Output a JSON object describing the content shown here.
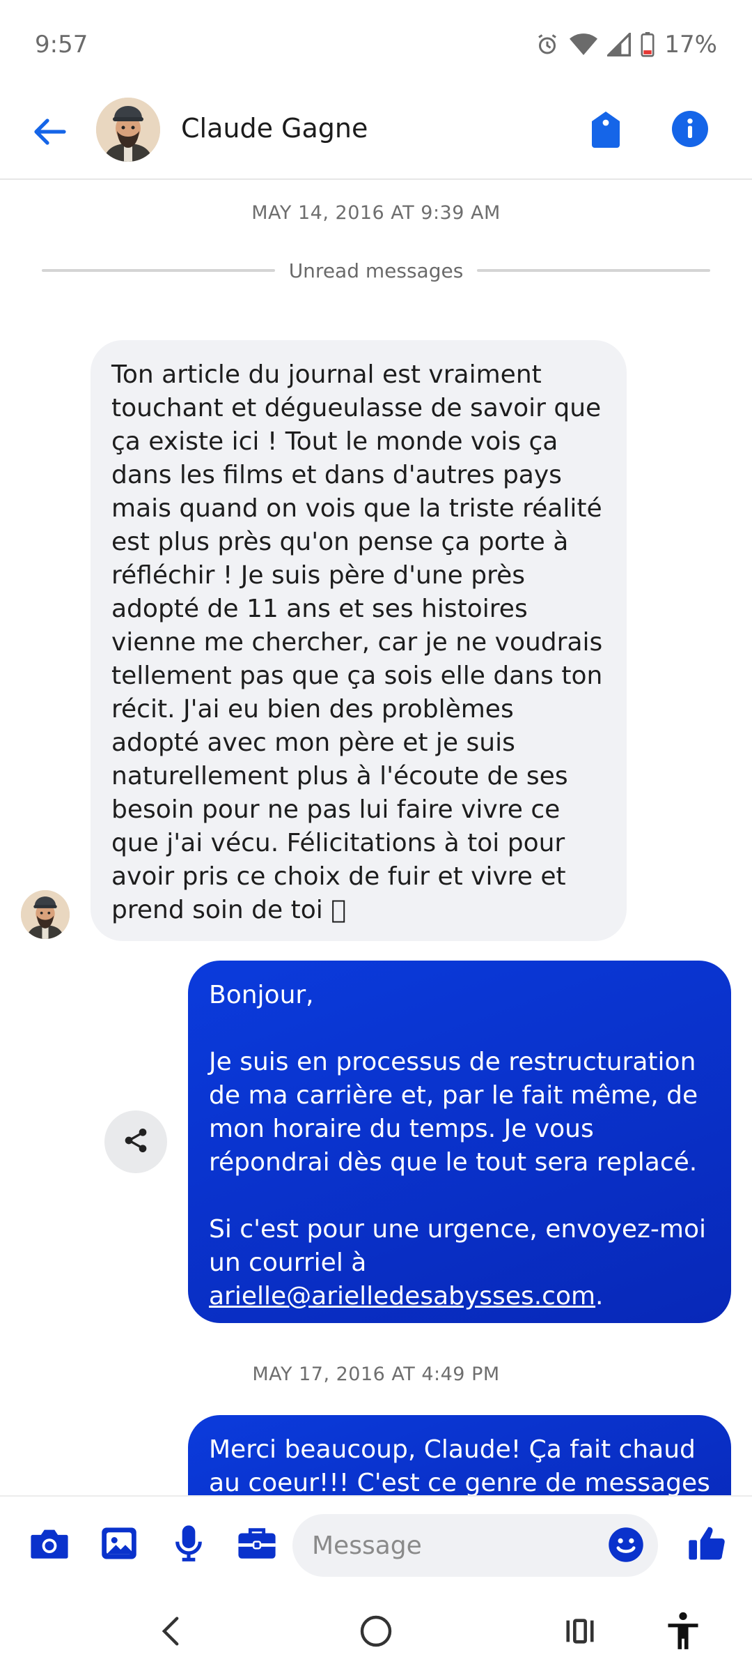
{
  "status_bar": {
    "time": "9:57",
    "battery": "17%",
    "icons": [
      "alarm-icon",
      "wifi-icon",
      "signal-icon",
      "battery-icon"
    ]
  },
  "header": {
    "contact_name": "Claude Gagne",
    "icons": [
      "back-arrow-icon",
      "tag-icon",
      "info-icon"
    ]
  },
  "conversation": {
    "timestamp_1": "MAY 14, 2016 AT 9:39 AM",
    "unread_label": "Unread messages",
    "incoming_message": "Ton article du journal est vraiment touchant et dégueulasse de savoir que ça existe ici ! Tout le monde vois ça dans les films et dans d'autres pays mais quand on vois que la triste réalité est plus près qu'on pense ça porte à réfléchir ! Je suis père d'une près adopté de 11 ans et ses histoires vienne me chercher, car je ne voudrais tellement pas que ça sois elle dans ton récit. J'ai eu bien des problèmes adopté avec mon père et je suis naturellement plus à l'écoute de ses besoin pour ne pas lui faire vivre ce que j'ai vécu. Félicitations à toi pour avoir pris ce choix de fuir et vivre et prend soin de toi 􏰀",
    "outgoing_message_1": {
      "greeting": "Bonjour,",
      "paragraph_1": "Je suis en processus de restructuration de ma carrière et, par le fait même, de mon horaire du temps. Je vous répondrai dès que le tout sera replacé.",
      "paragraph_2_prefix": "Si c'est pour une urgence, envoyez-moi un courriel à ",
      "email": "arielle@arielledesabysses.com",
      "paragraph_2_suffix": "."
    },
    "timestamp_2": "MAY 17, 2016 AT 4:49 PM",
    "outgoing_message_2": "Merci beaucoup, Claude! Ça fait chaud au coeur!!! C'est ce genre de messages"
  },
  "composer": {
    "placeholder": "Message",
    "icons": [
      "camera-icon",
      "gallery-icon",
      "microphone-icon",
      "briefcase-icon",
      "emoji-icon",
      "thumbs-up-icon"
    ]
  },
  "colors": {
    "accent": "#1565e8",
    "outgoing_bubble": "#0a32cc",
    "incoming_bubble": "#f1f2f5"
  }
}
